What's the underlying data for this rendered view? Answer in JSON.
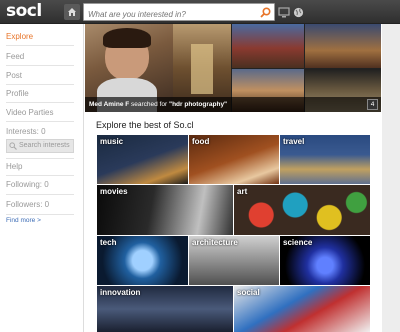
{
  "app": {
    "logo": "socl"
  },
  "search": {
    "placeholder": "What are you interested in?"
  },
  "sidebar": {
    "items": [
      {
        "label": "Explore"
      },
      {
        "label": "Feed"
      },
      {
        "label": "Post"
      },
      {
        "label": "Profile"
      },
      {
        "label": "Video Parties"
      },
      {
        "label": "Interests: 0"
      },
      {
        "label": "Help"
      },
      {
        "label": "Following: 0"
      },
      {
        "label": "Followers: 0"
      }
    ],
    "interest_search_placeholder": "Search interests",
    "find_more": "Find more >"
  },
  "hero": {
    "user": "Med Amine F",
    "action": "searched for",
    "query": "\"hdr photography\"",
    "count": "4"
  },
  "explore": {
    "title": "Explore the best of So.cl",
    "tiles": [
      {
        "label": "music"
      },
      {
        "label": "food"
      },
      {
        "label": "travel"
      },
      {
        "label": "movies"
      },
      {
        "label": "art"
      },
      {
        "label": "tech"
      },
      {
        "label": "architecture"
      },
      {
        "label": "science"
      },
      {
        "label": "innovation"
      },
      {
        "label": "social"
      }
    ]
  },
  "colors": {
    "accent": "#e8752a",
    "link": "#3b6bb5",
    "topbar": "#3a3a3a"
  }
}
